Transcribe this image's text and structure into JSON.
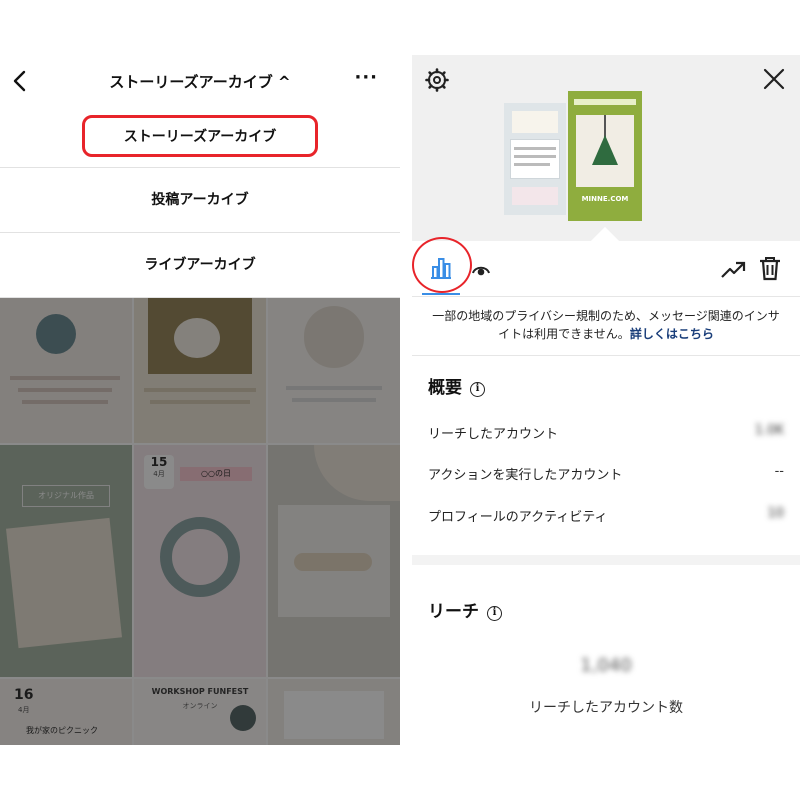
{
  "left": {
    "header": {
      "title": "ストーリーズアーカイブ ^",
      "more": "···"
    },
    "menu": [
      {
        "label": "ストーリーズアーカイブ"
      },
      {
        "label": "投稿アーカイブ"
      },
      {
        "label": "ライブアーカイブ"
      }
    ],
    "grid": {
      "tile_1_caption": "オリジナル作品",
      "tile_5_day": "15",
      "tile_5_month": "4月",
      "tile_5_heading": "○○の日",
      "tile_7_day": "16",
      "tile_7_month": "4月",
      "tile_7_caption": "我が家のピクニック",
      "tile_8_title": "WORKSHOP FUNFEST",
      "tile_8_sub": "オンライン"
    }
  },
  "right": {
    "thumb_b_label": "MINNE.COM",
    "notice_text": "一部の地域のプライバシー規制のため、メッセージ関連のインサイトは利用できません。",
    "notice_link": "詳しくはこちら",
    "overview": {
      "title": "概要",
      "rows": [
        {
          "label": "リーチしたアカウント",
          "value": "1.0K"
        },
        {
          "label": "アクションを実行したアカウント",
          "value": "--"
        },
        {
          "label": "プロフィールのアクティビティ",
          "value": "10"
        }
      ]
    },
    "reach": {
      "title": "リーチ",
      "number": "1,040",
      "label": "リーチしたアカウント数"
    },
    "colors": {
      "highlight": "#e8242a",
      "accent_blue": "#3a8ee6"
    },
    "icons": [
      "back-icon",
      "more-icon",
      "gear-icon",
      "close-icon",
      "bar-chart-icon",
      "eye-icon",
      "trend-icon",
      "trash-icon",
      "info-icon"
    ]
  }
}
